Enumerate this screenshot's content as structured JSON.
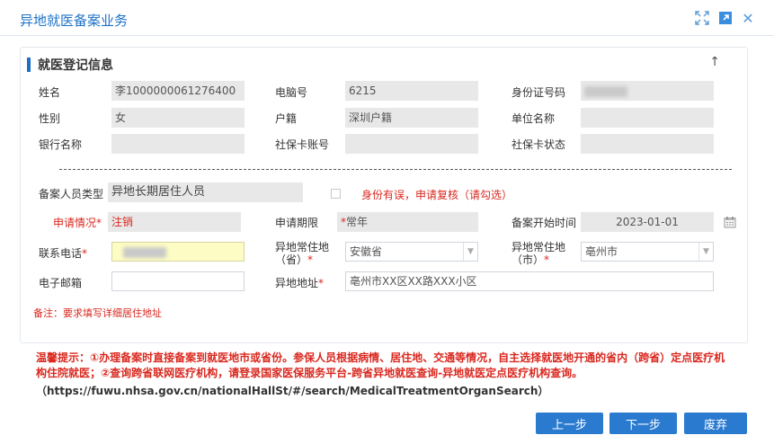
{
  "window": {
    "title": "异地就医备案业务"
  },
  "panel": {
    "title": "就医登记信息"
  },
  "basic": {
    "name_label": "姓名",
    "name_value": "李1000000061276400",
    "pc_label": "电脑号",
    "pc_value": "6215",
    "id_label": "身份证号码",
    "gender_label": "性别",
    "gender_value": "女",
    "huji_label": "户籍",
    "huji_value": "深圳户籍",
    "unit_label": "单位名称",
    "bank_label": "银行名称",
    "sscard_label": "社保卡账号",
    "sscard_status_label": "社保卡状态"
  },
  "filing": {
    "type_label": "备案人员类型",
    "type_value": "异地长期居住人员",
    "identity_check_label": "身份有误，申请复核（请勾选）",
    "apply_status_label": "申请情况",
    "apply_status_value": "注销",
    "apply_period_label": "申请期限",
    "apply_period_value": "常年",
    "start_date_label": "备案开始时间",
    "start_date_value": "2023-01-01",
    "phone_label": "联系电话",
    "province_label_1": "异地常住地",
    "province_label_2": "（省）",
    "province_value": "安徽省",
    "city_label_1": "异地常住地",
    "city_label_2": "（市）",
    "city_value": "亳州市",
    "email_label": "电子邮箱",
    "email_value": "",
    "address_label": "异地地址",
    "address_value": "亳州市XX区XX路XXX小区",
    "note": "备注：要求填写详细居住地址",
    "required_mark": "*"
  },
  "tip": {
    "text": "温馨提示：①办理备案时直接备案到就医地市或省份。参保人员根据病情、居住地、交通等情况，自主选择就医地开通的省内（跨省）定点医疗机构住院就医；②查询跨省联网医疗机构，请登录国家医保服务平台-跨省异地就医查询-异地就医定点医疗机构查询。",
    "url": "（https://fuwu.nhsa.gov.cn/nationalHallSt/#/search/MedicalTreatmentOrganSearch）"
  },
  "buttons": {
    "prev": "上一步",
    "next": "下一步",
    "abandon": "废弃"
  },
  "colors": {
    "accent": "#1e72c8",
    "button": "#2a7ad0",
    "required": "#d9281f",
    "readonly_bg": "#e8e8e8",
    "highlight_bg": "#fdfcc4"
  }
}
